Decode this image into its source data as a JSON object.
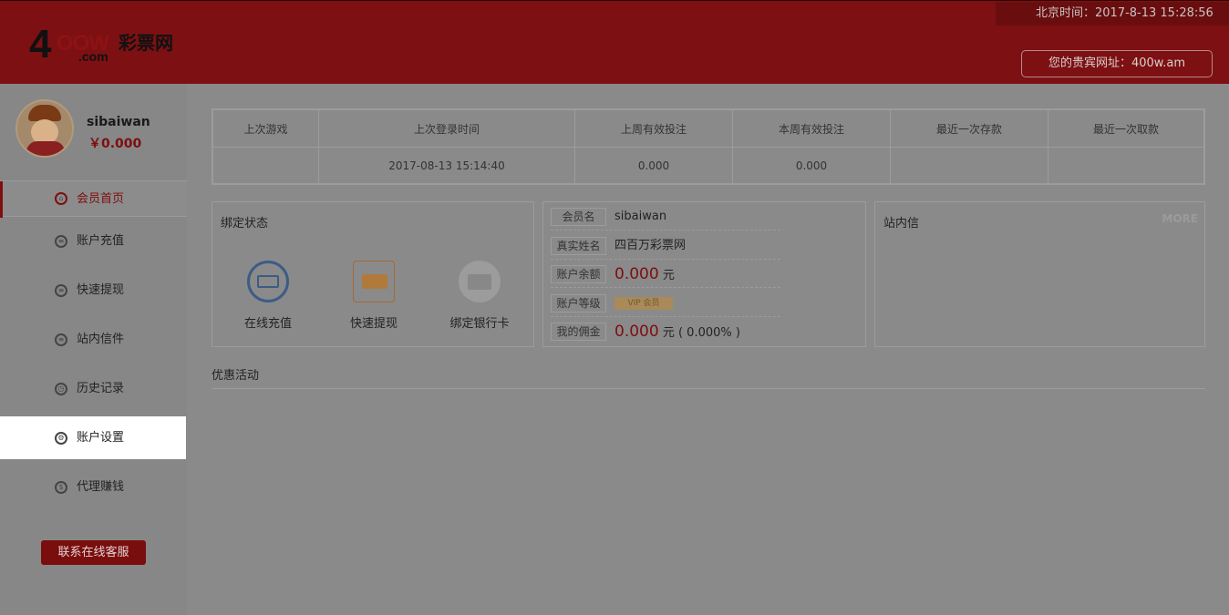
{
  "header": {
    "clock": "北京时间：2017-8-13 15:28:56",
    "logo": {
      "digit": "4",
      "letters": "OOW",
      "name": "彩票网",
      "suffix": ".com"
    },
    "vip_url": "您的贵宾网址：400w.am"
  },
  "profile": {
    "username": "sibaiwan",
    "balance": "￥0.000"
  },
  "nav": [
    {
      "label": "会员首页",
      "icon": "home-icon"
    },
    {
      "label": "账户充值",
      "icon": "coins-icon"
    },
    {
      "label": "快速提现",
      "icon": "cash-icon"
    },
    {
      "label": "站内信件",
      "icon": "mail-icon"
    },
    {
      "label": "历史记录",
      "icon": "clock-icon"
    },
    {
      "label": "账户设置",
      "icon": "gear-icon"
    },
    {
      "label": "代理赚钱",
      "icon": "money-bag-icon"
    }
  ],
  "contact_label": "联系在线客服",
  "stats": {
    "headers": [
      "上次游戏",
      "上次登录时间",
      "上周有效投注",
      "本周有效投注",
      "最近一次存款",
      "最近一次取款"
    ],
    "values": [
      "",
      "2017-08-13 15:14:40",
      "0.000",
      "0.000",
      "",
      ""
    ]
  },
  "binding": {
    "title": "绑定状态",
    "items": [
      {
        "label": "在线充值",
        "icon": "online-deposit-icon"
      },
      {
        "label": "快速提现",
        "icon": "quick-withdraw-icon"
      },
      {
        "label": "绑定银行卡",
        "icon": "bank-card-icon"
      }
    ]
  },
  "member": {
    "name_key": "会员名",
    "name_val": "sibaiwan",
    "real_key": "真实姓名",
    "real_val": "四百万彩票网",
    "balance_key": "账户余额",
    "balance_num": "0.000",
    "balance_unit": "元",
    "level_key": "账户等级",
    "level_badge": "VIP 会员",
    "commission_key": "我的佣金",
    "commission_num": "0.000",
    "commission_unit": "元",
    "commission_pct": "( 0.000% )"
  },
  "messages": {
    "title": "站内信",
    "more": "MORE"
  },
  "promo_title": "优惠活动",
  "colors": {
    "header_red": "#7d1012",
    "accent_red": "#7e0e0e",
    "overlay_gray": "#8a8a8a"
  }
}
